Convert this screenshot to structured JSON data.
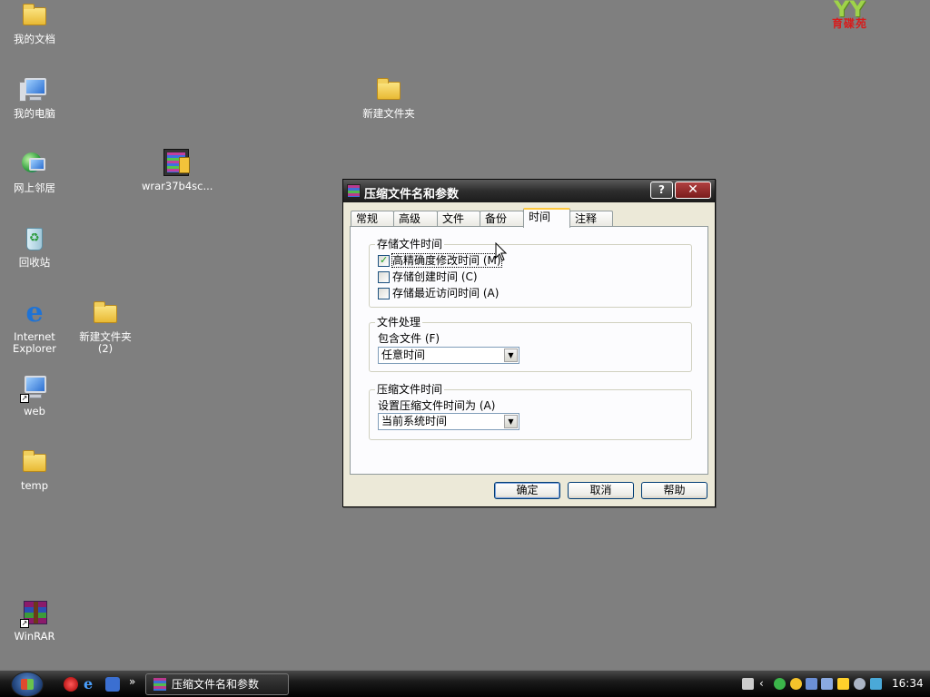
{
  "desktop": {
    "icons": [
      {
        "label": "我的文档"
      },
      {
        "label": "我的电脑"
      },
      {
        "label": "网上邻居"
      },
      {
        "label": "回收站"
      },
      {
        "label": "Internet Explorer"
      },
      {
        "label": "web"
      },
      {
        "label": "temp"
      },
      {
        "label": "WinRAR"
      },
      {
        "label": "wrar37b4sc..."
      },
      {
        "label": "新建文件夹 (2)"
      },
      {
        "label": "新建文件夹"
      }
    ],
    "logo_text": "YY",
    "logo_sub": "育碟苑"
  },
  "dialog": {
    "title": "压缩文件名和参数",
    "help_glyph": "?",
    "close_glyph": "✕",
    "tabs": [
      {
        "label": "常规"
      },
      {
        "label": "高级"
      },
      {
        "label": "文件"
      },
      {
        "label": "备份"
      },
      {
        "label": "时间",
        "active": true
      },
      {
        "label": "注释"
      }
    ],
    "store_time": {
      "title": "存储文件时间",
      "options": [
        {
          "label": "高精确度修改时间 (M)",
          "checked": true
        },
        {
          "label": "存储创建时间 (C)",
          "checked": false
        },
        {
          "label": "存储最近访问时间 (A)",
          "checked": false
        }
      ]
    },
    "file_processing": {
      "title": "文件处理",
      "include_label": "包含文件 (F)",
      "include_value": "任意时间"
    },
    "archive_time": {
      "title": "压缩文件时间",
      "set_label": "设置压缩文件时间为 (A)",
      "set_value": "当前系统时间"
    },
    "buttons": {
      "ok": "确定",
      "cancel": "取消",
      "help": "帮助"
    }
  },
  "taskbar": {
    "more": "»",
    "ie_glyph": "e",
    "task_title": "压缩文件名和参数",
    "clock": "16:34"
  }
}
